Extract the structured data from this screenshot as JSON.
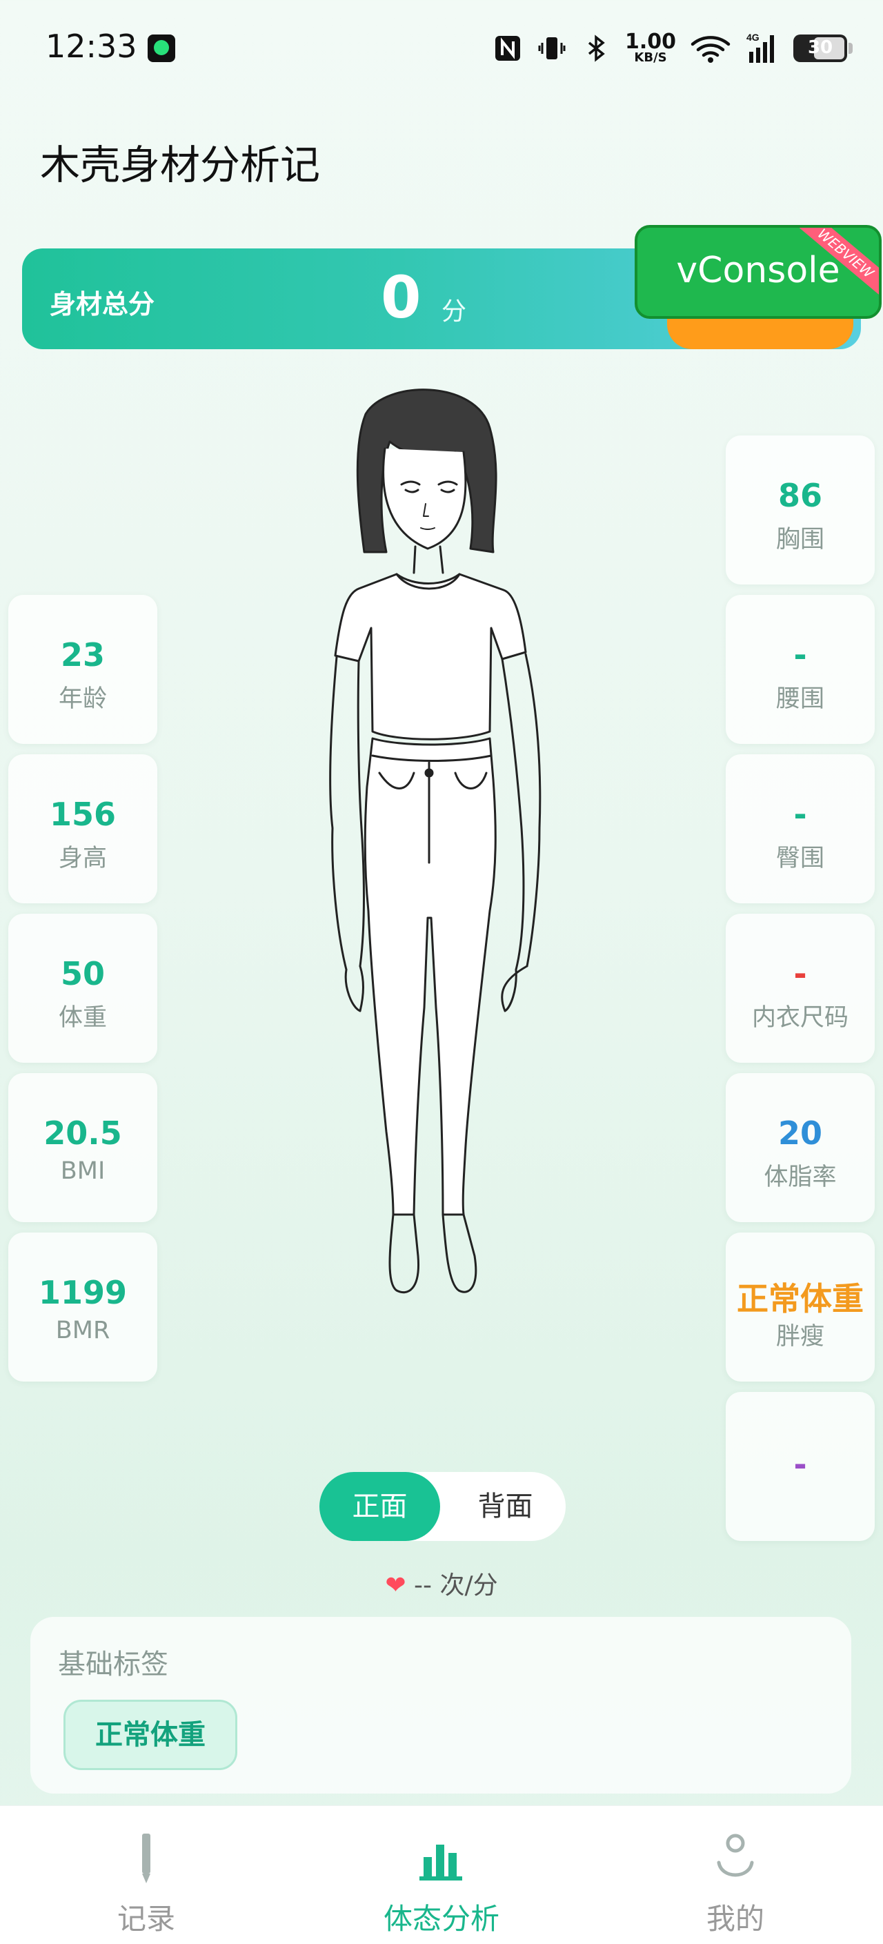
{
  "status_bar": {
    "time": "12:33",
    "speed_value": "1.00",
    "speed_unit": "KB/S",
    "network": "4G",
    "battery": "30"
  },
  "header": {
    "title": "木壳身材分析记"
  },
  "score": {
    "label": "身材总分",
    "value": "0",
    "unit": "分"
  },
  "vconsole": {
    "label": "vConsole",
    "ribbon": "WEBVIEW"
  },
  "left_metrics": [
    {
      "value": "23",
      "label": "年龄"
    },
    {
      "value": "156",
      "label": "身高"
    },
    {
      "value": "50",
      "label": "体重"
    },
    {
      "value": "20.5",
      "label": "BMI"
    },
    {
      "value": "1199",
      "label": "BMR"
    }
  ],
  "right_metrics": [
    {
      "value": "86",
      "label": "胸围",
      "color": "#19b68c"
    },
    {
      "value": "-",
      "label": "腰围",
      "color": "#19b68c"
    },
    {
      "value": "-",
      "label": "臀围",
      "color": "#19b68c"
    },
    {
      "value": "-",
      "label": "内衣尺码",
      "color": "#e8413c"
    },
    {
      "value": "20",
      "label": "体脂率",
      "color": "#2f8fd8"
    },
    {
      "value": "正常体重",
      "label": "胖瘦",
      "color": "#f39a1e"
    },
    {
      "value": "-",
      "label": "",
      "color": "#9b4fc8"
    }
  ],
  "view_toggle": {
    "front": "正面",
    "back": "背面",
    "selected": "front"
  },
  "heart_rate": {
    "text": "-- 次/分"
  },
  "tags": {
    "title": "基础标签",
    "items": [
      "正常体重"
    ]
  },
  "bottom_nav": [
    {
      "label": "记录",
      "icon": "pen-icon"
    },
    {
      "label": "体态分析",
      "icon": "bar-chart-icon",
      "active": true
    },
    {
      "label": "我的",
      "icon": "person-icon"
    }
  ]
}
